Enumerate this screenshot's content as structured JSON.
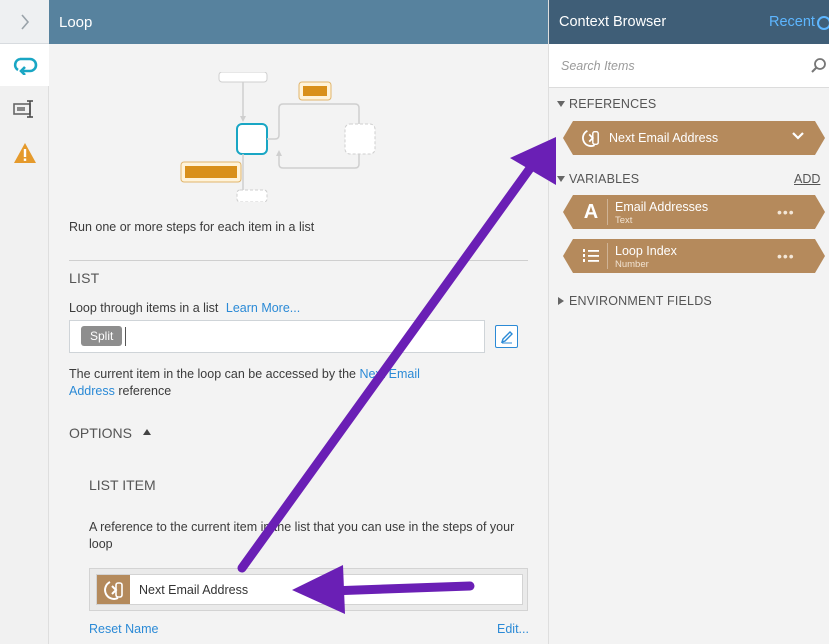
{
  "header": {
    "title": "Loop"
  },
  "main": {
    "description": "Run one or more steps for each item in a list",
    "list_section": "LIST",
    "loop_through": "Loop through items in a list",
    "learn_more": "Learn More...",
    "chip": "Split",
    "current_text_before": "The current item in the loop can be accessed by the ",
    "current_text_link": "Next Email Address",
    "current_text_after": " reference",
    "options_label": "OPTIONS",
    "list_item_label": "LIST ITEM",
    "ref_text": "A reference to the current item in the list that you can use in the steps of your loop",
    "ref_name": "Next Email Address",
    "reset_name": "Reset Name",
    "edit": "Edit..."
  },
  "context_browser": {
    "title": "Context Browser",
    "recent": "Recent",
    "search_placeholder": "Search Items",
    "references_label": "REFERENCES",
    "reference_item": "Next Email Address",
    "variables_label": "VARIABLES",
    "add": "ADD",
    "variables": [
      {
        "name": "Email Addresses",
        "type": "Text",
        "icon": "text-icon"
      },
      {
        "name": "Loop Index",
        "type": "Number",
        "icon": "numbered-list-icon"
      }
    ],
    "environment_label": "ENVIRONMENT FIELDS"
  },
  "colors": {
    "header": "#57829e",
    "cb_header": "#3f5e77",
    "accent_blue": "#2f96e8",
    "pill_brown": "#b58a5c",
    "annotation_purple": "#6a1fb5"
  }
}
